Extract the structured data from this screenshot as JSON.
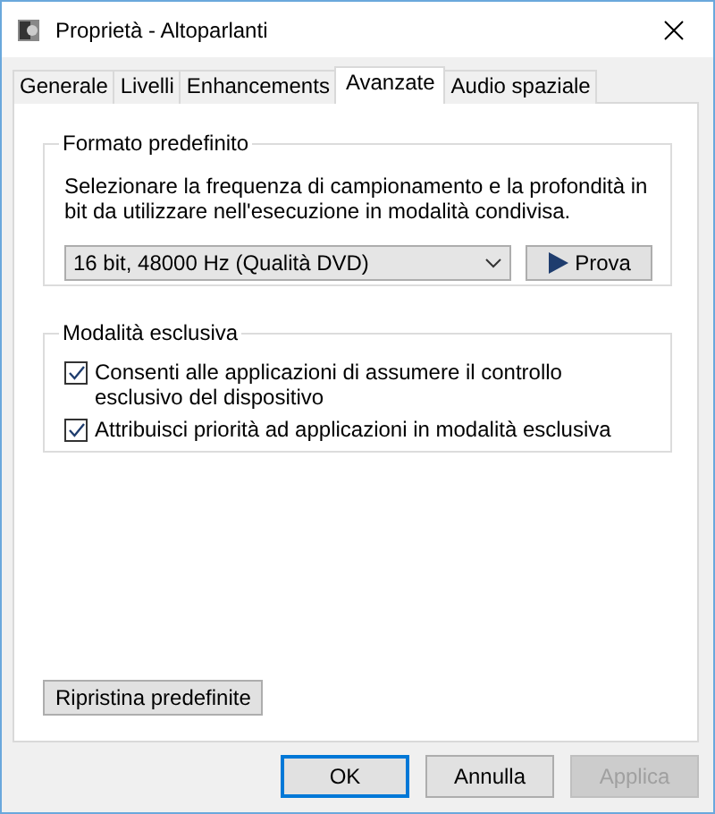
{
  "window": {
    "title": "Proprietà - Altoparlanti"
  },
  "tabs": [
    {
      "label": "Generale",
      "selected": false
    },
    {
      "label": "Livelli",
      "selected": false
    },
    {
      "label": "Enhancements",
      "selected": false
    },
    {
      "label": "Avanzate",
      "selected": true
    },
    {
      "label": "Audio spaziale",
      "selected": false
    }
  ],
  "default_format": {
    "title": "Formato predefinito",
    "description": "Selezionare la frequenza di campionamento e la profondità in bit da utilizzare nell'esecuzione in modalità condivisa.",
    "format_select": {
      "value": "16 bit, 48000 Hz (Qualità DVD)"
    },
    "test_button": "Prova"
  },
  "exclusive_mode": {
    "title": "Modalità esclusiva",
    "options": [
      {
        "label": "Consenti alle applicazioni di assumere il controllo esclusivo del dispositivo",
        "checked": true
      },
      {
        "label": "Attribuisci priorità ad applicazioni in modalità esclusiva",
        "checked": true
      }
    ]
  },
  "restore_button": "Ripristina predefinite",
  "buttons": [
    {
      "label": "OK",
      "default": true,
      "disabled": false
    },
    {
      "label": "Annulla",
      "default": false,
      "disabled": false
    },
    {
      "label": "Applica",
      "default": false,
      "disabled": true
    }
  ]
}
